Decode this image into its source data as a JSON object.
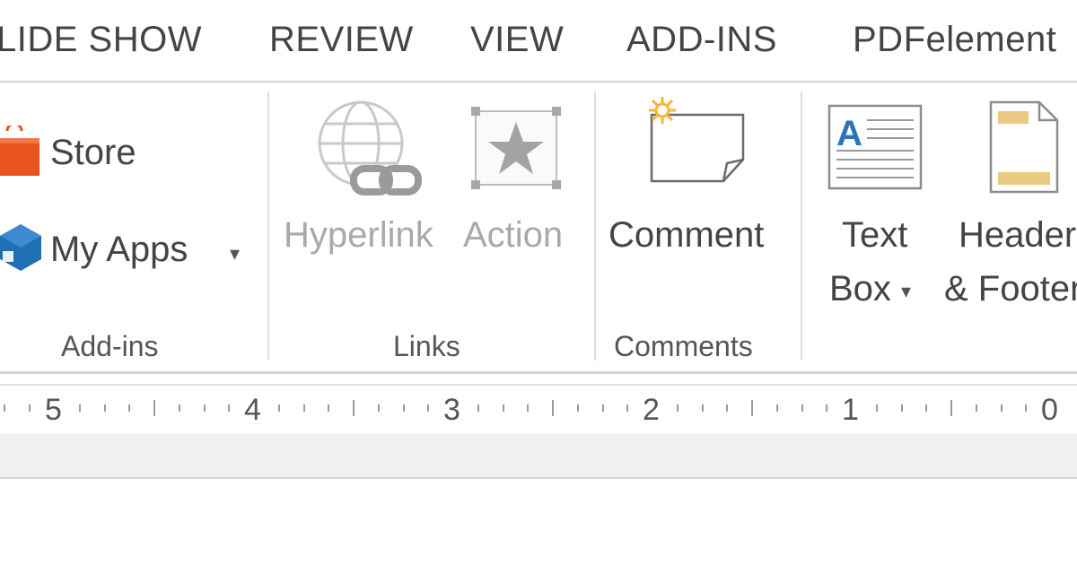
{
  "tabs": [
    "LIDE SHOW",
    "REVIEW",
    "VIEW",
    "ADD-INS",
    "PDFelement"
  ],
  "groups": {
    "addins": {
      "label": "Add-ins",
      "store_label": "Store",
      "myapps_label": "My Apps",
      "myapps_arrow": "▾"
    },
    "links": {
      "label": "Links",
      "hyperlink_label": "Hyperlink",
      "action_label": "Action"
    },
    "comments": {
      "label": "Comments",
      "comment_label": "Comment"
    },
    "text": {
      "textbox_line1": "Text",
      "textbox_line2": "Box",
      "textbox_arrow": "▾",
      "header_line1": "Header",
      "header_line2": "& Footer"
    }
  },
  "ruler": {
    "numbers": [
      "5",
      "4",
      "3",
      "2",
      "1",
      "0"
    ]
  },
  "colors": {
    "store_orange": "#e8541c",
    "myapps_blue": "#1e6fb5",
    "comment_star": "#f3b73a",
    "textbox_blue": "#2e75b6",
    "header_tan": "#ecc982",
    "disabled_gray": "#a9a9a9"
  },
  "icons": {
    "store": "store-bag-icon",
    "myapps": "my-apps-cube-icon",
    "hyperlink": "globe-link-icon",
    "action": "star-action-icon",
    "comment": "comment-note-icon",
    "textbox": "text-box-icon",
    "header": "header-footer-icon"
  }
}
